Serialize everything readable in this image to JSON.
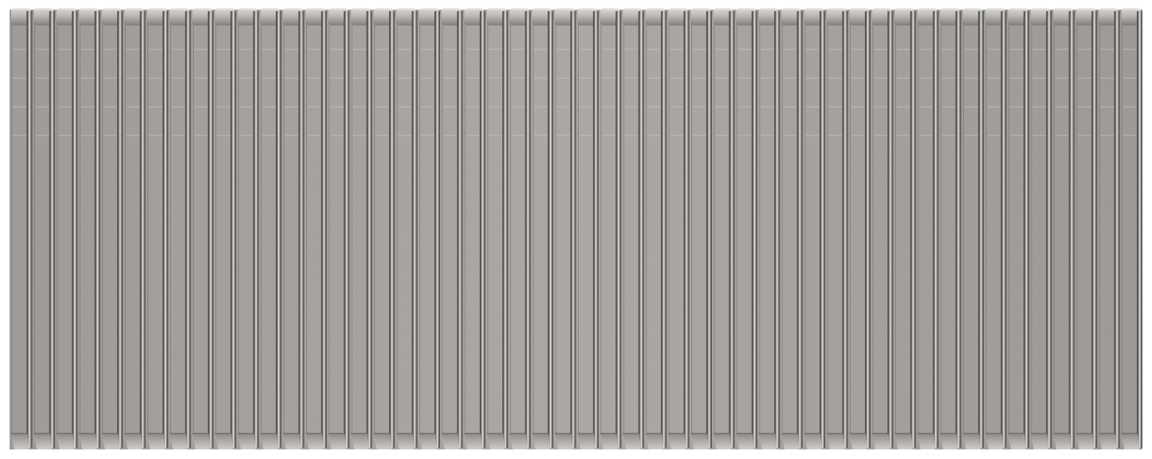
{
  "image": {
    "subject": "staples",
    "strip_count": 50,
    "colors": {
      "background": "#ffffff",
      "metal_base": "#a3a09c",
      "metal_light": "#c5c2be",
      "metal_dark": "#55534f",
      "metal_shadow": "#3a3936",
      "highlight": "#e9e8e6"
    }
  }
}
